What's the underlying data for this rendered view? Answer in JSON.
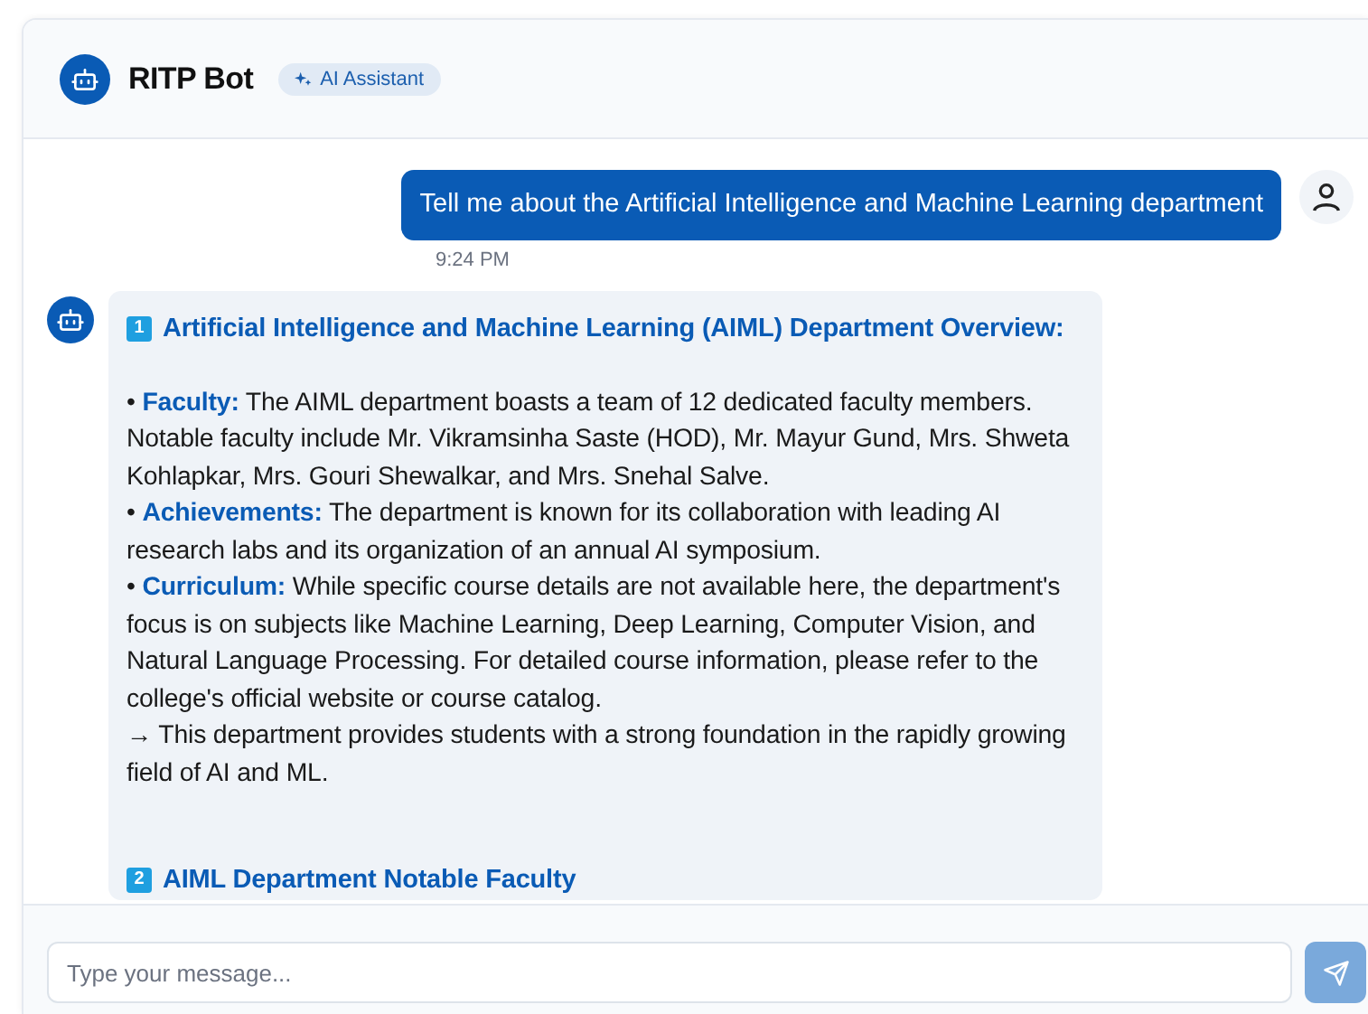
{
  "header": {
    "title": "RITP Bot",
    "badge": "AI Assistant"
  },
  "messages": [
    {
      "kind": "user",
      "text": "Tell me about the Artificial Intelligence and Machine Learning department",
      "time": "9:24 PM"
    },
    {
      "kind": "bot",
      "sections": [
        {
          "number": "1",
          "heading": "Artificial Intelligence and Machine Learning (AIML) Department Overview:",
          "lines": [
            "• **Faculty:** The AIML department boasts a team of 12 dedicated faculty members. Notable faculty include Mr. Vikramsinha Saste (HOD), Mr. Mayur Gund, Mrs. Shweta Kohlapkar, Mrs. Gouri Shewalkar, and Mrs. Snehal Salve.",
            "• **Achievements:** The department is known for its collaboration with leading AI research labs and its organization of an annual AI symposium.",
            "• **Curriculum:** While specific course details are not available here, the department's focus is on subjects like Machine Learning, Deep Learning, Computer Vision, and Natural Language Processing. For detailed course information, please refer to the college's official website or course catalog.",
            "→ This department provides students with a strong foundation in the rapidly growing field of AI and ML."
          ]
        },
        {
          "number": "2",
          "heading": "AIML Department Notable Faculty"
        }
      ]
    }
  ],
  "composer": {
    "placeholder": "Type your message...",
    "send_disabled": true
  }
}
